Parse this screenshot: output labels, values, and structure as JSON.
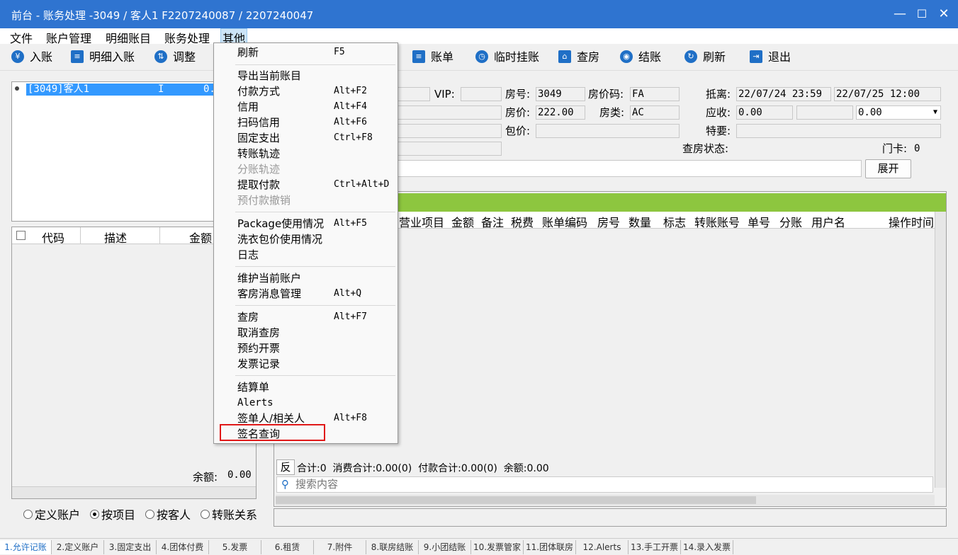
{
  "window": {
    "title": "前台 - 账务处理 -3049 / 客人1 F2207240087 / 2207240047"
  },
  "menubar": [
    "文件",
    "账户管理",
    "明细账目",
    "账务处理",
    "其他"
  ],
  "toolbar": [
    {
      "label": "入账",
      "icon": "yen-icon"
    },
    {
      "label": "明细入账",
      "icon": "ledger-icon"
    },
    {
      "label": "调整",
      "icon": "adjust-icon"
    },
    {
      "label": "账单",
      "icon": "bill-icon"
    },
    {
      "label": "临时挂账",
      "icon": "clock-icon"
    },
    {
      "label": "查房",
      "icon": "house-search-icon"
    },
    {
      "label": "结账",
      "icon": "coins-icon"
    },
    {
      "label": "刷新",
      "icon": "refresh-icon"
    },
    {
      "label": "退出",
      "icon": "exit-icon"
    }
  ],
  "guest_list": {
    "row": {
      "name": "[3049]客人1",
      "flag": "I",
      "amount": "0."
    }
  },
  "left_grid": {
    "headers": [
      "代码",
      "描述",
      "金额"
    ],
    "balance_label": "余额:",
    "balance_value": "0.00"
  },
  "radios": [
    {
      "label": "定义账户",
      "checked": false
    },
    {
      "label": "按项目",
      "checked": true
    },
    {
      "label": "按客人",
      "checked": false
    },
    {
      "label": "转账关系",
      "checked": false
    }
  ],
  "info": {
    "vip_label": "VIP:",
    "room_label": "房号:",
    "room": "3049",
    "rate_code_label": "房价码:",
    "rate_code": "FA",
    "arrive_label": "抵离:",
    "arrive": "22/07/24 23:59",
    "depart": "22/07/25 12:00",
    "price_label": "房价:",
    "price": "222.00",
    "room_type_label": "房类:",
    "room_type": "AC",
    "receivable_label": "应收:",
    "receivable": "0.00",
    "receivable_select": "0.00",
    "package_label": "包价:",
    "special_label": "特要:",
    "checkroom_label": "查房状态:",
    "card_label": "门卡:",
    "card": "0",
    "expand_button": "展开"
  },
  "main_grid": {
    "headers": [
      "营业项目",
      "金额",
      "备注",
      "税费",
      "账单编码",
      "房号",
      "数量",
      "标志",
      "转账账号",
      "单号",
      "分账",
      "用户名",
      "操作时间"
    ]
  },
  "summary": {
    "reverse_button": "反",
    "text": "合计:0  消费合计:0.00(0)  付款合计:0.00(0)  余额:0.00"
  },
  "search": {
    "placeholder": "搜索内容"
  },
  "menu_items": [
    {
      "label": "刷新",
      "shortcut": "F5",
      "disabled": false
    },
    {
      "label": "导出当前账目",
      "shortcut": "",
      "disabled": false
    },
    {
      "label": "付款方式",
      "shortcut": "Alt+F2",
      "disabled": false
    },
    {
      "label": "信用",
      "shortcut": "Alt+F4",
      "disabled": false
    },
    {
      "label": "扫码信用",
      "shortcut": "Alt+F6",
      "disabled": false
    },
    {
      "label": "固定支出",
      "shortcut": "Ctrl+F8",
      "disabled": false
    },
    {
      "label": "转账轨迹",
      "shortcut": "",
      "disabled": false
    },
    {
      "label": "分账轨迹",
      "shortcut": "",
      "disabled": true
    },
    {
      "label": "提取付款",
      "shortcut": "Ctrl+Alt+D",
      "disabled": false
    },
    {
      "label": "预付款撤销",
      "shortcut": "",
      "disabled": true
    },
    {
      "label": "Package使用情况",
      "shortcut": "Alt+F5",
      "disabled": false
    },
    {
      "label": "洗衣包价使用情况",
      "shortcut": "",
      "disabled": false
    },
    {
      "label": "日志",
      "shortcut": "",
      "disabled": false
    },
    {
      "label": "维护当前账户",
      "shortcut": "",
      "disabled": false
    },
    {
      "label": "客房消息管理",
      "shortcut": "Alt+Q",
      "disabled": false
    },
    {
      "label": "查房",
      "shortcut": "Alt+F7",
      "disabled": false
    },
    {
      "label": "取消查房",
      "shortcut": "",
      "disabled": false
    },
    {
      "label": "预约开票",
      "shortcut": "",
      "disabled": false
    },
    {
      "label": "发票记录",
      "shortcut": "",
      "disabled": false
    },
    {
      "label": "结算单",
      "shortcut": "",
      "disabled": false
    },
    {
      "label": "Alerts",
      "shortcut": "",
      "disabled": false
    },
    {
      "label": "签单人/相关人",
      "shortcut": "Alt+F8",
      "disabled": false
    },
    {
      "label": "签名查询",
      "shortcut": "",
      "disabled": false
    }
  ],
  "status_tabs": [
    "1.允许记账",
    "2.定义账户",
    "3.固定支出",
    "4.团体付费",
    "5.发票",
    "6.租赁",
    "7.附件",
    "8.联房结账",
    "9.小团结账",
    "10.发票管家",
    "11.团体联房",
    "12.Alerts",
    "13.手工开票",
    "14.录入发票"
  ],
  "colors": {
    "titlebar": "#2f74d0",
    "selection": "#3399ff",
    "green_bar": "#8dc63f",
    "highlight_box": "#e01818"
  }
}
